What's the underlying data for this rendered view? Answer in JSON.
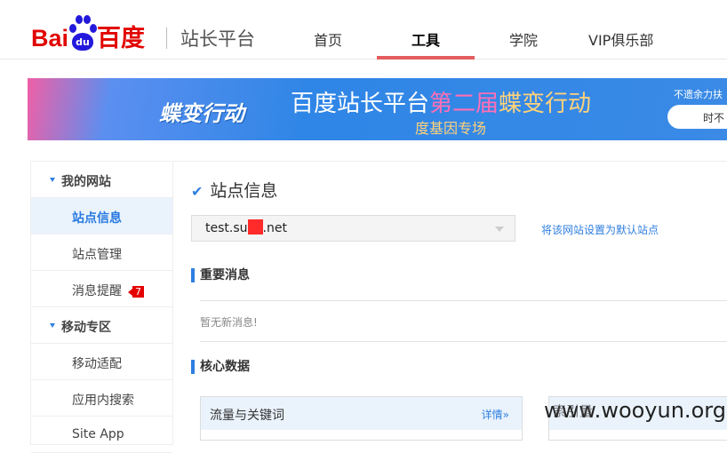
{
  "header": {
    "logo_text": "Bai",
    "logo_du": "du",
    "logo_cn": "百度",
    "site_name": "站长平台",
    "nav": [
      "首页",
      "工具",
      "学院",
      "VIP俱乐部"
    ],
    "active_nav": 1
  },
  "banner": {
    "logo": "蝶变行动",
    "title_white": "百度站长平台",
    "title_pink": "第二届",
    "title_orange": "蝶变行动",
    "subtitle": "度基因专场",
    "right_text": "不遗余力扶",
    "button": "时不"
  },
  "sidebar": {
    "items": [
      {
        "label": "我的网站",
        "group": true
      },
      {
        "label": "站点信息",
        "active": true
      },
      {
        "label": "站点管理"
      },
      {
        "label": "消息提醒",
        "badge": "7"
      },
      {
        "label": "移动专区",
        "group": true
      },
      {
        "label": "移动适配"
      },
      {
        "label": "应用内搜索"
      },
      {
        "label": "Site App"
      }
    ]
  },
  "main": {
    "title": "站点信息",
    "site_prefix": "test.su",
    "site_suffix": ".net",
    "set_default_link": "将该网站设置为默认站点",
    "section_messages": "重要消息",
    "no_messages": "暂无新消息!",
    "section_core": "核心数据",
    "card1_title": "流量与关键词",
    "card1_more": "详情»",
    "card2_title": "索引量",
    "watermark": "www.wooyun.org"
  },
  "colors": {
    "accent": "#2f7fe0",
    "brand_red": "#e10601",
    "nav_underline": "#e35d5e"
  }
}
